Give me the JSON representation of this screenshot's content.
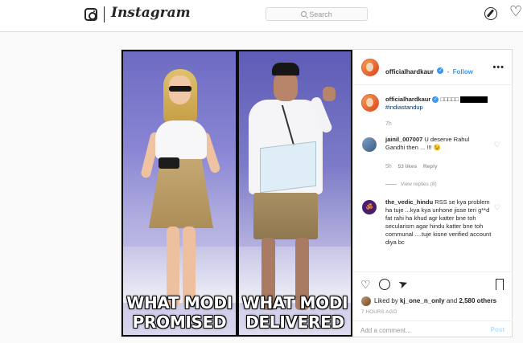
{
  "nav": {
    "brand": "Instagram",
    "search_placeholder": "Search",
    "icons": [
      "camera-icon",
      "explore-icon",
      "heart-icon"
    ]
  },
  "post": {
    "media": {
      "left_caption": [
        "WHAT MODI",
        "PROMISED"
      ],
      "right_caption": [
        "WHAT MODI",
        "DELIVERED"
      ]
    },
    "header": {
      "username": "officialhardkaur",
      "separator": "•",
      "follow_label": "Follow",
      "more": "•••"
    },
    "caption": {
      "username": "officialhardkaur",
      "text": "□□□□□",
      "hashtag": "#indiastandup",
      "time": "7h"
    },
    "comments": [
      {
        "username": "jainil_007007",
        "text": "U deserve Rahul Gandhi then ... !!! 😉",
        "time": "5h",
        "likes": "53 likes",
        "reply": "Reply",
        "view_replies": "View replies (8)"
      },
      {
        "username": "the_vedic_hindu",
        "avatar_glyph": "ॐ",
        "text": "RSS se kya problem ha tuje ...kya kya unhone jisse teri g**d fat rahi ha khud agr katter bne toh secularism agar hindu katter bne toh communal ....tuje kisne verified account diya bc"
      }
    ],
    "likes": {
      "liked_by": "Liked by",
      "user": "kj_one_n_only",
      "and": "and",
      "count": "2,580 others"
    },
    "timestamp": "7 HOURS AGO",
    "add_comment_placeholder": "Add a comment...",
    "post_button": "Post"
  },
  "colors": {
    "link_blue": "#3897f0",
    "border": "#dbdbdb",
    "muted": "#999999"
  }
}
